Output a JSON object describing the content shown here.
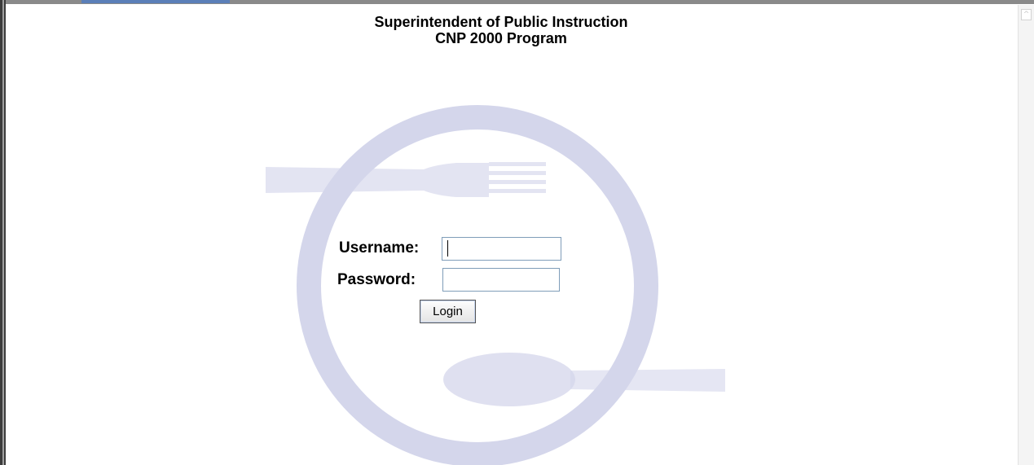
{
  "header": {
    "line1": "Superintendent of Public Instruction",
    "line2": "CNP 2000 Program"
  },
  "login": {
    "username_label": "Username:",
    "password_label": "Password:",
    "username_value": "",
    "password_value": "",
    "login_button": "Login"
  },
  "watermark": {
    "icon": "plate-fork-spoon-watermark",
    "color": "#d4d6eb"
  },
  "scrollbar": {
    "up_glyph": "^"
  }
}
